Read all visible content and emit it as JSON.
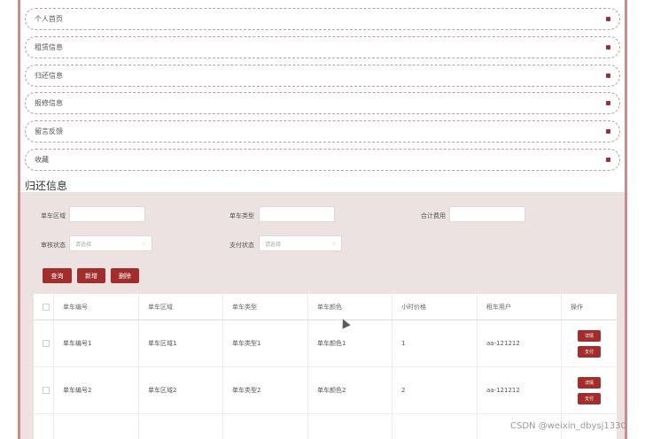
{
  "menu": {
    "items": [
      {
        "label": "个人首页"
      },
      {
        "label": "租赁信息"
      },
      {
        "label": "归还信息"
      },
      {
        "label": "报修信息"
      },
      {
        "label": "留言反馈"
      },
      {
        "label": "收藏"
      }
    ]
  },
  "page": {
    "title": "归还信息"
  },
  "filters": {
    "area_label": "单车区域",
    "type_label": "单车类型",
    "total_label": "合计费用",
    "review_label": "审核状态",
    "pay_label": "支付状态",
    "review_placeholder": "请选择",
    "pay_placeholder": "请选择"
  },
  "actions": {
    "query": "查询",
    "add": "新增",
    "delete": "删除"
  },
  "table": {
    "headers": [
      "单车编号",
      "单车区域",
      "单车类型",
      "单车颜色",
      "小时价格",
      "租车用户",
      "操作"
    ],
    "rows": [
      {
        "cells": [
          "单车编号1",
          "单车区域1",
          "单车类型1",
          "单车颜色1",
          "1",
          "aa-121212"
        ],
        "detail": "详情",
        "pay": "支付"
      },
      {
        "cells": [
          "单车编号2",
          "单车区域2",
          "单车类型2",
          "单车颜色2",
          "2",
          "aa-121212"
        ],
        "detail": "详情",
        "pay": "支付"
      }
    ]
  },
  "watermark": "CSDN @weixin_dbysj1330",
  "colors": {
    "accent": "#a32d2d",
    "panel": "#ece2e2",
    "frame": "#c98b8b"
  }
}
